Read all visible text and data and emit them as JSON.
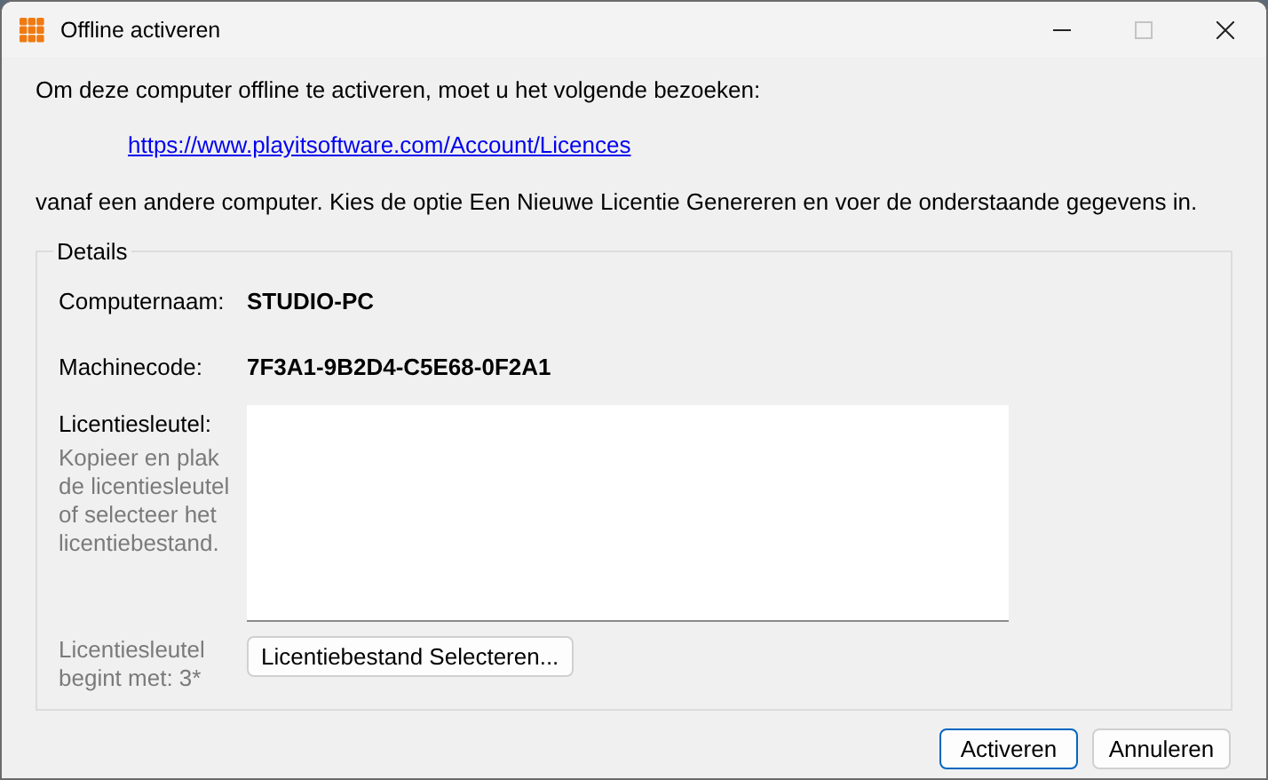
{
  "window": {
    "title": "Offline activeren",
    "controls": [
      {
        "kind": "minimize",
        "disabled": false
      },
      {
        "kind": "maximize",
        "disabled": true
      },
      {
        "kind": "close",
        "disabled": false
      }
    ]
  },
  "intro": "Om deze computer offline te activeren, moet u het volgende bezoeken:",
  "link": "https://www.playitsoftware.com/Account/Licences",
  "instruction": "vanaf een andere computer. Kies de optie Een Nieuwe Licentie Genereren en voer de onderstaande gegevens in.",
  "details": {
    "legend": "Details",
    "fields": [
      {
        "label": "Computernaam:",
        "value": "STUDIO-PC"
      },
      {
        "label": "Machinecode:",
        "value": "7F3A1-9B2D4-C5E68-0F2A1"
      }
    ],
    "license": {
      "label": "Licentiesleutel:",
      "hint": "Kopieer en plak de licentiesleutel of selecteer het licentiebestand.",
      "note": "Licentiesleutel begint met: 3*",
      "button": "Licentiebestand Selecteren..."
    }
  },
  "buttons": [
    {
      "label": "Activeren",
      "default": true
    },
    {
      "label": "Annuleren",
      "default": false
    }
  ]
}
